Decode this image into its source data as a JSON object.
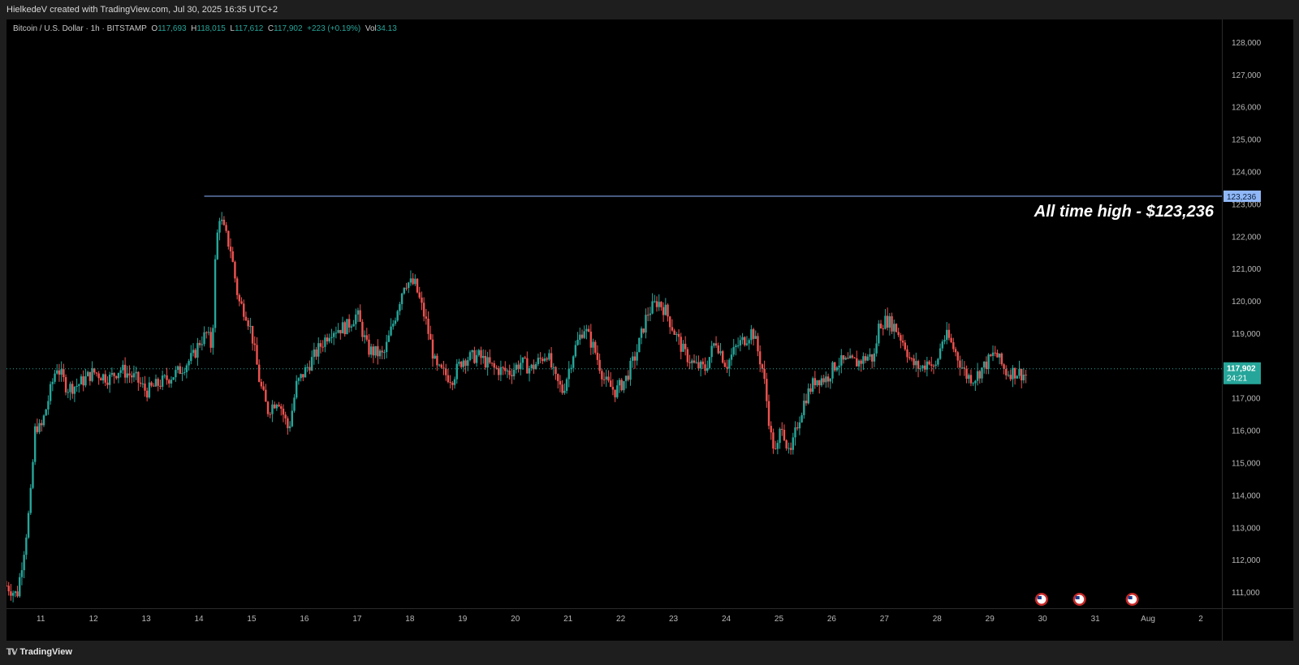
{
  "header": {
    "attribution": "HielkedeV created with TradingView.com, Jul 30, 2025 16:35 UTC+2"
  },
  "legend": {
    "symbol": "Bitcoin / U.S. Dollar · 1h · BITSTAMP",
    "open_key": "O",
    "open": "117,693",
    "high_key": "H",
    "high": "118,015",
    "low_key": "L",
    "low": "117,612",
    "close_key": "C",
    "close": "117,902",
    "change": "+223 (+0.19%)",
    "vol_key": "Vol",
    "vol": "34.13"
  },
  "footer": {
    "brand": "TradingView",
    "logo_icon": "tradingview-logo-icon"
  },
  "colors": {
    "up": "#26a69a",
    "down": "#ef5350",
    "ath_line": "#7fa3e8",
    "price_badge": "#26a69a",
    "ath_badge": "#90b8f8",
    "background": "#000000"
  },
  "chart_data": {
    "type": "candlestick",
    "title": "Bitcoin / U.S. Dollar · 1h · BITSTAMP",
    "ylim": [
      110500,
      128700
    ],
    "y_ticks": [
      111000,
      112000,
      113000,
      114000,
      115000,
      116000,
      117000,
      118000,
      119000,
      120000,
      121000,
      122000,
      123000,
      124000,
      125000,
      126000,
      127000,
      128000
    ],
    "y_tick_labels": [
      "111,000",
      "112,000",
      "113,000",
      "114,000",
      "115,000",
      "116,000",
      "117,000",
      "118,000",
      "119,000",
      "120,000",
      "121,000",
      "122,000",
      "123,000",
      "124,000",
      "125,000",
      "126,000",
      "127,000",
      "128,000"
    ],
    "x_ticks": [
      11,
      12,
      13,
      14,
      15,
      16,
      17,
      18,
      19,
      20,
      21,
      22,
      23,
      24,
      25,
      26,
      27,
      28,
      29,
      30,
      31,
      32,
      33
    ],
    "x_tick_labels": [
      "11",
      "12",
      "13",
      "14",
      "15",
      "16",
      "17",
      "18",
      "19",
      "20",
      "21",
      "22",
      "23",
      "24",
      "25",
      "26",
      "27",
      "28",
      "29",
      "30",
      "31",
      "Aug",
      "2"
    ],
    "xlim": [
      10.35,
      33.4
    ],
    "hourly_close_path": [
      [
        10.35,
        111200
      ],
      [
        10.55,
        110900
      ],
      [
        10.7,
        112500
      ],
      [
        10.8,
        113800
      ],
      [
        10.9,
        116200
      ],
      [
        11.0,
        116000
      ],
      [
        11.15,
        117000
      ],
      [
        11.3,
        118000
      ],
      [
        11.5,
        117300
      ],
      [
        11.7,
        117400
      ],
      [
        12.0,
        117800
      ],
      [
        12.3,
        117600
      ],
      [
        12.5,
        117900
      ],
      [
        12.8,
        117600
      ],
      [
        13.0,
        117200
      ],
      [
        13.3,
        117500
      ],
      [
        13.6,
        117800
      ],
      [
        13.9,
        118300
      ],
      [
        14.0,
        118700
      ],
      [
        14.15,
        119000
      ],
      [
        14.25,
        118500
      ],
      [
        14.3,
        121000
      ],
      [
        14.38,
        122700
      ],
      [
        14.45,
        122300
      ],
      [
        14.6,
        121600
      ],
      [
        14.75,
        120000
      ],
      [
        14.9,
        119600
      ],
      [
        15.0,
        119000
      ],
      [
        15.15,
        117500
      ],
      [
        15.3,
        116600
      ],
      [
        15.5,
        117000
      ],
      [
        15.7,
        116000
      ],
      [
        15.85,
        117400
      ],
      [
        16.0,
        117800
      ],
      [
        16.3,
        118600
      ],
      [
        16.5,
        119100
      ],
      [
        16.8,
        119200
      ],
      [
        17.0,
        119600
      ],
      [
        17.2,
        118500
      ],
      [
        17.5,
        118300
      ],
      [
        17.7,
        119400
      ],
      [
        17.9,
        120600
      ],
      [
        18.1,
        120500
      ],
      [
        18.3,
        119400
      ],
      [
        18.5,
        117900
      ],
      [
        18.8,
        117600
      ],
      [
        19.0,
        118200
      ],
      [
        19.3,
        118300
      ],
      [
        19.6,
        117900
      ],
      [
        19.9,
        117800
      ],
      [
        20.1,
        118100
      ],
      [
        20.3,
        117900
      ],
      [
        20.6,
        118400
      ],
      [
        20.75,
        117600
      ],
      [
        20.9,
        117200
      ],
      [
        21.1,
        118400
      ],
      [
        21.3,
        119200
      ],
      [
        21.5,
        118500
      ],
      [
        21.7,
        117500
      ],
      [
        21.9,
        117200
      ],
      [
        22.1,
        117600
      ],
      [
        22.3,
        118400
      ],
      [
        22.5,
        119600
      ],
      [
        22.7,
        120000
      ],
      [
        22.85,
        119700
      ],
      [
        23.0,
        119100
      ],
      [
        23.2,
        118400
      ],
      [
        23.4,
        118000
      ],
      [
        23.6,
        117900
      ],
      [
        23.8,
        118800
      ],
      [
        24.0,
        118000
      ],
      [
        24.2,
        118600
      ],
      [
        24.4,
        118900
      ],
      [
        24.5,
        119100
      ],
      [
        24.7,
        117800
      ],
      [
        24.85,
        115800
      ],
      [
        24.95,
        115200
      ],
      [
        25.05,
        116300
      ],
      [
        25.2,
        115100
      ],
      [
        25.35,
        116200
      ],
      [
        25.5,
        117000
      ],
      [
        25.7,
        117600
      ],
      [
        25.9,
        117600
      ],
      [
        26.1,
        118100
      ],
      [
        26.3,
        118100
      ],
      [
        26.5,
        118100
      ],
      [
        26.7,
        118300
      ],
      [
        26.8,
        118200
      ],
      [
        26.9,
        119300
      ],
      [
        27.05,
        119400
      ],
      [
        27.2,
        119200
      ],
      [
        27.4,
        118600
      ],
      [
        27.5,
        118100
      ],
      [
        27.7,
        117900
      ],
      [
        27.85,
        118200
      ],
      [
        27.95,
        117800
      ],
      [
        28.1,
        118800
      ],
      [
        28.2,
        118900
      ],
      [
        28.35,
        118400
      ],
      [
        28.55,
        117700
      ],
      [
        28.7,
        117600
      ],
      [
        28.9,
        118000
      ],
      [
        29.1,
        118400
      ],
      [
        29.3,
        117800
      ],
      [
        29.5,
        117800
      ],
      [
        29.7,
        117700
      ]
    ],
    "lines": [
      {
        "label": "All time high - $123,236",
        "value": 123236,
        "from_x": 14.1,
        "badge": "123,236"
      }
    ],
    "last_price": {
      "value": 117902,
      "label": "117,902",
      "countdown": "24:21"
    },
    "event_markers": [
      {
        "x": 29.98,
        "icon": "us-flag-icon"
      },
      {
        "x": 30.7,
        "icon": "us-flag-icon"
      },
      {
        "x": 31.7,
        "icon": "us-flag-icon"
      }
    ],
    "grid": false
  }
}
